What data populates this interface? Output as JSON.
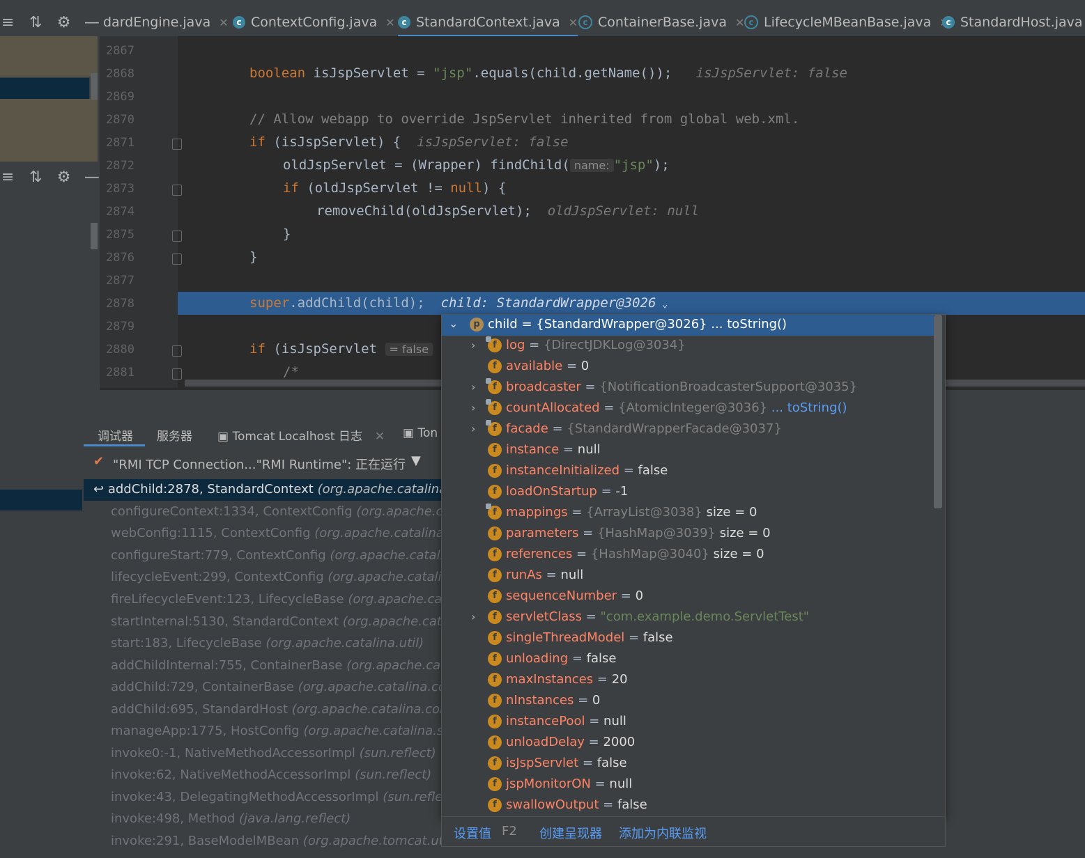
{
  "tabs": [
    {
      "label": "dardEngine.java",
      "icon": "class-icon",
      "active": false
    },
    {
      "label": "ContextConfig.java",
      "icon": "class-icon",
      "active": false
    },
    {
      "label": "StandardContext.java",
      "icon": "class-icon",
      "active": true
    },
    {
      "label": "ContainerBase.java",
      "icon": "abstract-class-icon",
      "active": false
    },
    {
      "label": "LifecycleMBeanBase.java",
      "icon": "abstract-class-icon",
      "active": false
    },
    {
      "label": "StandardHost.java",
      "icon": "class-icon",
      "active": false
    }
  ],
  "gutter": [
    "2867",
    "2868",
    "2869",
    "2870",
    "2871",
    "2872",
    "2873",
    "2874",
    "2875",
    "2876",
    "2877",
    "2878",
    "2879",
    "2880",
    "2881"
  ],
  "code": {
    "l2868": {
      "kw": "boolean",
      "text": " isJspServlet = ",
      "str": "\"jsp\"",
      "text2": ".equals(child.getName());",
      "hint": "isJspServlet: false"
    },
    "l2870": {
      "comment": "// Allow webapp to override JspServlet inherited from global web.xml."
    },
    "l2871": {
      "kw": "if",
      "text": " (isJspServlet) {",
      "hint": "isJspServlet: false"
    },
    "l2872": {
      "text": "oldJspServlet = (Wrapper) findChild(",
      "param": "name:",
      "str": "\"jsp\"",
      "text2": ");"
    },
    "l2873": {
      "kw": "if",
      "text": " (oldJspServlet != ",
      "kw2": "null",
      "text2": ") {"
    },
    "l2874": {
      "text": "removeChild(oldJspServlet);",
      "hint": "oldJspServlet: null"
    },
    "l2875": {
      "text": "}"
    },
    "l2876": {
      "text": "}"
    },
    "l2878": {
      "kw": "super",
      "text": ".addChild(child);",
      "hint": "child: StandardWrapper@3026"
    },
    "l2880": {
      "kw": "if",
      "text": " (isJspServlet",
      "param": "= false"
    },
    "l2881": {
      "comment": "/*"
    }
  },
  "bottom_tabs": [
    {
      "label": "调试器"
    },
    {
      "label": "服务器"
    },
    {
      "label": "Tomcat Localhost 日志"
    },
    {
      "label": "Ton"
    }
  ],
  "thread": {
    "label": "\"RMI TCP Connection...\"RMI Runtime\": 正在运行"
  },
  "frames": [
    {
      "method": "addChild:2878, StandardContext",
      "pkg": "(org.apache.catalina.c"
    },
    {
      "method": "configureContext:1334, ContextConfig",
      "pkg": "(org.apache.cata"
    },
    {
      "method": "webConfig:1115, ContextConfig",
      "pkg": "(org.apache.catalina.st"
    },
    {
      "method": "configureStart:779, ContextConfig",
      "pkg": "(org.apache.catalina."
    },
    {
      "method": "lifecycleEvent:299, ContextConfig",
      "pkg": "(org.apache.catalina.s"
    },
    {
      "method": "fireLifecycleEvent:123, LifecycleBase",
      "pkg": "(org.apache.catalin"
    },
    {
      "method": "startInternal:5130, StandardContext",
      "pkg": "(org.apache.catalir"
    },
    {
      "method": "start:183, LifecycleBase",
      "pkg": "(org.apache.catalina.util)"
    },
    {
      "method": "addChildInternal:755, ContainerBase",
      "pkg": "(org.apache.catali"
    },
    {
      "method": "addChild:729, ContainerBase",
      "pkg": "(org.apache.catalina.core)"
    },
    {
      "method": "addChild:695, StandardHost",
      "pkg": "(org.apache.catalina.core)"
    },
    {
      "method": "manageApp:1775, HostConfig",
      "pkg": "(org.apache.catalina.star"
    },
    {
      "method": "invoke0:-1, NativeMethodAccessorImpl",
      "pkg": "(sun.reflect)"
    },
    {
      "method": "invoke:62, NativeMethodAccessorImpl",
      "pkg": "(sun.reflect)"
    },
    {
      "method": "invoke:43, DelegatingMethodAccessorImpl",
      "pkg": "(sun.reflect."
    },
    {
      "method": "invoke:498, Method",
      "pkg": "(java.lang.reflect)"
    },
    {
      "method": "invoke:291, BaseModelMBean",
      "pkg": "(org.apache.tomcat.util.m"
    }
  ],
  "popup": {
    "root": {
      "name": "child",
      "ref": "{StandardWrapper@3026}",
      "link": "... toString()"
    },
    "fields": [
      {
        "name": "log",
        "ref": "{DirectJDKLog@3034}",
        "expand": true,
        "lock": true
      },
      {
        "name": "available",
        "value": "0"
      },
      {
        "name": "broadcaster",
        "ref": "{NotificationBroadcasterSupport@3035}",
        "expand": true,
        "lock": true
      },
      {
        "name": "countAllocated",
        "ref": "{AtomicInteger@3036}",
        "link": "... toString()",
        "expand": true,
        "lock": true
      },
      {
        "name": "facade",
        "ref": "{StandardWrapperFacade@3037}",
        "expand": true,
        "lock": true
      },
      {
        "name": "instance",
        "value": "null"
      },
      {
        "name": "instanceInitialized",
        "value": "false"
      },
      {
        "name": "loadOnStartup",
        "value": "-1"
      },
      {
        "name": "mappings",
        "ref": "{ArrayList@3038}",
        "extra": "size = 0",
        "lock": true
      },
      {
        "name": "parameters",
        "ref": "{HashMap@3039}",
        "extra": "size = 0"
      },
      {
        "name": "references",
        "ref": "{HashMap@3040}",
        "extra": "size = 0"
      },
      {
        "name": "runAs",
        "value": "null"
      },
      {
        "name": "sequenceNumber",
        "value": "0"
      },
      {
        "name": "servletClass",
        "str": "\"com.example.demo.ServletTest\"",
        "expand": true
      },
      {
        "name": "singleThreadModel",
        "value": "false"
      },
      {
        "name": "unloading",
        "value": "false"
      },
      {
        "name": "maxInstances",
        "value": "20"
      },
      {
        "name": "nInstances",
        "value": "0"
      },
      {
        "name": "instancePool",
        "value": "null"
      },
      {
        "name": "unloadDelay",
        "value": "2000"
      },
      {
        "name": "isJspServlet",
        "value": "false"
      },
      {
        "name": "jspMonitorON",
        "value": "null"
      },
      {
        "name": "swallowOutput",
        "value": "false"
      }
    ],
    "footer": {
      "set_value": "设置值",
      "set_value_key": "F2",
      "create_renderer": "创建呈现器",
      "add_inline_watch": "添加为内联监视"
    }
  },
  "colors": {
    "accent": "#2d5c91",
    "field_name": "#ff8364",
    "link": "#589df6",
    "string": "#6a8759",
    "keyword": "#cc7832"
  }
}
